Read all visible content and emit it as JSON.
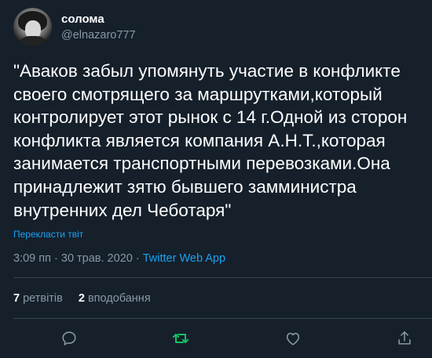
{
  "user": {
    "display_name": "солома",
    "handle": "@elnazaro777"
  },
  "tweet": {
    "text": "\"Аваков забыл упомянуть участие в конфликте\nсвоего смотрящего за маршрутками,который\nконтролирует этот рынок с 14 г.Одной из сторон\nконфликта является компания А.Н.Т.,которая\nзанимается транспортными перевозками.Она\nпринадлежит зятю бывшего замминистра\nвнутренних дел Чеботаря\"",
    "translate_label": "Перекласти твіт",
    "time": "3:09 пп",
    "separator": "·",
    "date": "30 трав. 2020",
    "app": "Twitter Web App"
  },
  "stats": {
    "retweets_count": "7",
    "retweets_label": "ретвітів",
    "likes_count": "2",
    "likes_label": "вподобання"
  },
  "actions": {
    "reply_icon": "reply-icon",
    "retweet_icon": "retweet-icon",
    "like_icon": "like-icon",
    "share_icon": "share-icon"
  },
  "colors": {
    "background": "#15202b",
    "link": "#1da1f2",
    "secondary_text": "#8899a6",
    "retweet_active": "#17bf63",
    "divider": "#38444d"
  }
}
